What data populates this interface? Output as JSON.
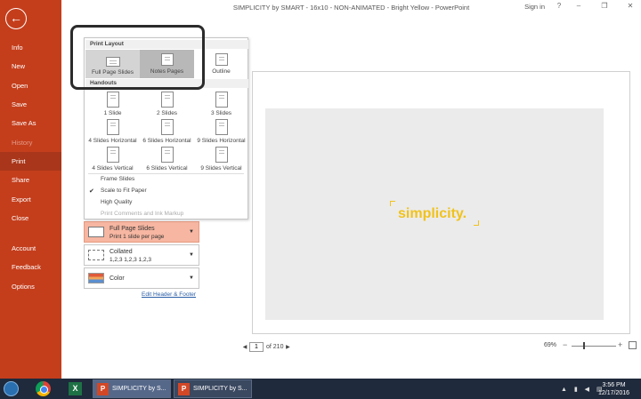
{
  "window": {
    "title": "SIMPLICITY by SMART - 16x10 - NON-ANIMATED - Bright Yellow  -  PowerPoint",
    "signin": "Sign in",
    "help": "?",
    "minimize": "–",
    "restore": "❐",
    "close": "✕"
  },
  "sidebar": {
    "back": "←",
    "items": [
      {
        "label": "Info"
      },
      {
        "label": "New"
      },
      {
        "label": "Open"
      },
      {
        "label": "Save"
      },
      {
        "label": "Save As"
      },
      {
        "label": "History"
      },
      {
        "label": "Print"
      },
      {
        "label": "Share"
      },
      {
        "label": "Export"
      },
      {
        "label": "Close"
      },
      {
        "label": "Account"
      },
      {
        "label": "Feedback"
      },
      {
        "label": "Options"
      }
    ]
  },
  "dropdown": {
    "print_layout_header": "Print Layout",
    "layouts": [
      "Full Page Slides",
      "Notes Pages",
      "Outline"
    ],
    "handouts_header": "Handouts",
    "handouts": [
      "1 Slide",
      "2 Slides",
      "3 Slides",
      "4 Slides Horizontal",
      "6 Slides Horizontal",
      "9 Slides Horizontal",
      "4 Slides Vertical",
      "6 Slides Vertical",
      "9 Slides Vertical"
    ],
    "options": {
      "frame_slides": "Frame Slides",
      "scale_to_fit": "Scale to Fit Paper",
      "high_quality": "High Quality",
      "print_comments": "Print Comments and Ink Markup"
    },
    "check": "✔"
  },
  "settings": {
    "layout_main": "Full Page Slides",
    "layout_sub": "Print 1 slide per page",
    "collate_main": "Collated",
    "collate_sub": "1,2,3     1,2,3     1,2,3",
    "color_main": "Color",
    "caret": "▼",
    "edit_header_footer": "Edit Header & Footer"
  },
  "preview": {
    "logo_text": "simplicity."
  },
  "nav": {
    "prev": "◀",
    "page": "1",
    "of": "of 210",
    "next": "▶"
  },
  "zoom": {
    "level": "69%",
    "minus": "−",
    "plus": "+"
  },
  "taskbar": {
    "app_label": "SIMPLICITY by S...",
    "app_label_2": "SIMPLICITY by S...",
    "excel": "X",
    "pp": "P",
    "pp2": "P",
    "tray": "▲ ▮ ◀ ▤",
    "time": "3:56 PM",
    "date": "12/17/2016"
  },
  "colors": {
    "backstage": "#c43e1c",
    "accent_yellow": "#f1c21b",
    "selected_setting": "#f6b6a1"
  }
}
